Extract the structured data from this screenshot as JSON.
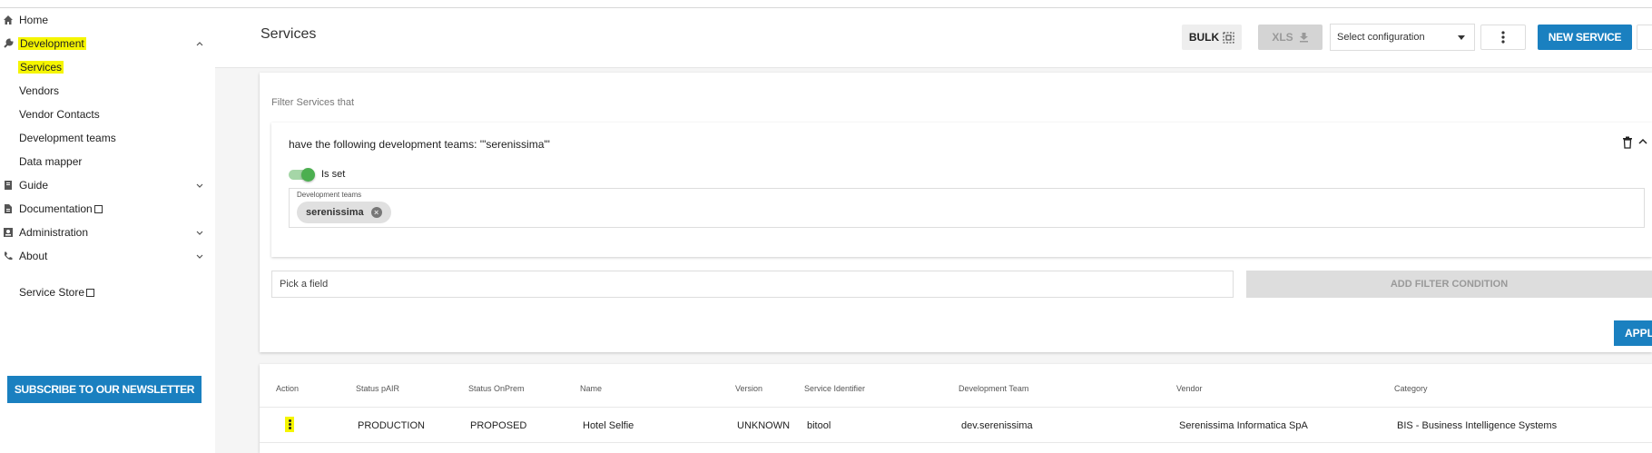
{
  "sidebar": {
    "items": [
      {
        "label": "Home",
        "icon": "home-icon"
      },
      {
        "label": "Development",
        "icon": "wrench-icon",
        "expanded": true,
        "highlighted": true
      },
      {
        "label": "Services",
        "highlighted": true,
        "selected": true
      },
      {
        "label": "Vendors"
      },
      {
        "label": "Vendor Contacts"
      },
      {
        "label": "Development teams"
      },
      {
        "label": "Data mapper"
      },
      {
        "label": "Guide",
        "icon": "book-icon",
        "chevron": "down"
      },
      {
        "label": "Documentation",
        "icon": "document-icon",
        "external": true
      },
      {
        "label": "Administration",
        "icon": "admin-icon",
        "chevron": "down"
      },
      {
        "label": "About",
        "icon": "phone-icon",
        "chevron": "down"
      },
      {
        "label": "Service Store",
        "external": true
      }
    ],
    "subscribe_label": "SUBSCRIBE TO OUR NEWSLETTER"
  },
  "header": {
    "title": "Services",
    "bulk_label": "BULK",
    "xls_label": "XLS",
    "select_config_value": "Select configuration",
    "new_service_label": "NEW SERVICE"
  },
  "filter": {
    "heading": "Filter Services that",
    "condition_text": "have the following development teams: '\"serenissima\"'",
    "toggle_label": "Is set",
    "field_label": "Development teams",
    "chip_value": "serenissima",
    "pick_field_placeholder": "Pick a field",
    "add_condition_label": "ADD FILTER CONDITION",
    "apply_label": "APPLY"
  },
  "table": {
    "columns": [
      "Action",
      "Status pAIR",
      "Status OnPrem",
      "Name",
      "Version",
      "Service Identifier",
      "Development Team",
      "Vendor",
      "Category"
    ],
    "rows": [
      {
        "status_pair": "PRODUCTION",
        "status_onprem": "PROPOSED",
        "name": "Hotel Selfie",
        "version": "UNKNOWN",
        "service_identifier": "bitool",
        "development_team": "dev.serenissima",
        "vendor": "Serenissima Informatica SpA",
        "category": "BIS - Business Intelligence Systems"
      }
    ]
  },
  "colors": {
    "accent": "#1a80c0",
    "highlight": "#f5f500",
    "toggle_on": "#4caf50"
  }
}
